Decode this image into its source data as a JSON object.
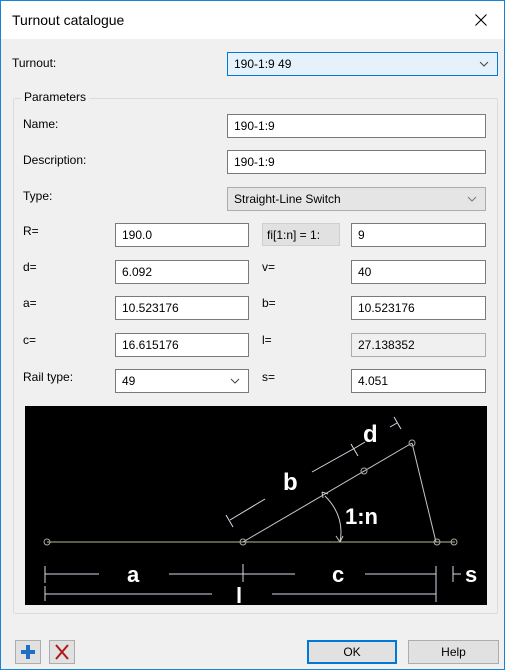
{
  "window": {
    "title": "Turnout catalogue"
  },
  "turnout": {
    "label": "Turnout:",
    "value": "190-1:9 49"
  },
  "parameters": {
    "group_title": "Parameters",
    "name": {
      "label": "Name:",
      "value": "190-1:9"
    },
    "description": {
      "label": "Description:",
      "value": "190-1:9"
    },
    "type": {
      "label": "Type:",
      "value": "Straight-Line Switch"
    },
    "R": {
      "label": "R=",
      "value": "190.0"
    },
    "fi": {
      "label": "fi[1:n] = 1:",
      "value": "9"
    },
    "d": {
      "label": "d=",
      "value": "6.092"
    },
    "v": {
      "label": "v=",
      "value": "40"
    },
    "a": {
      "label": "a=",
      "value": "10.523176"
    },
    "b": {
      "label": "b=",
      "value": "10.523176"
    },
    "c": {
      "label": "c=",
      "value": "16.615176"
    },
    "l": {
      "label": "l=",
      "value": "27.138352"
    },
    "rail_type": {
      "label": "Rail type:",
      "value": "49"
    },
    "s": {
      "label": "s=",
      "value": "4.051"
    }
  },
  "diagram": {
    "labels": {
      "a": "a",
      "b": "b",
      "c": "c",
      "d": "d",
      "l": "l",
      "s": "s",
      "angle": "1:n"
    },
    "colors": {
      "background": "#000000",
      "line": "#c8c8a0",
      "dim": "#d8d8e8",
      "text": "#ffffff"
    }
  },
  "footer": {
    "add_icon": "plus-icon",
    "delete_icon": "x-icon",
    "ok_label": "OK",
    "help_label": "Help"
  },
  "colors": {
    "accent": "#0078d7",
    "border_window": "#1883d7",
    "add": "#1f6fc5",
    "delete": "#b01818"
  }
}
